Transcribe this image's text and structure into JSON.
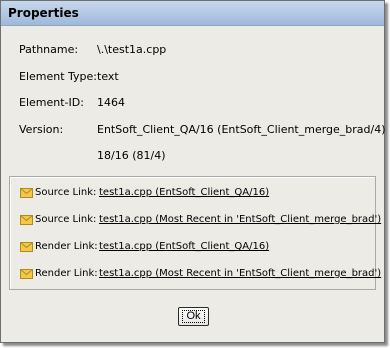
{
  "window": {
    "title": "Properties"
  },
  "properties": [
    {
      "label": "Pathname:",
      "value": "\\.\\test1a.cpp"
    },
    {
      "label": "Element Type:",
      "value": "text"
    },
    {
      "label": "Element-ID:",
      "value": "1464"
    },
    {
      "label": "Version:",
      "value": "EntSoft_Client_QA/16 (EntSoft_Client_merge_brad/4)"
    },
    {
      "label": "",
      "value": "18/16 (81/4)"
    }
  ],
  "links": [
    {
      "icon": "envelope-icon",
      "label": "Source Link:",
      "text": "test1a.cpp (EntSoft_Client_QA/16)"
    },
    {
      "icon": "envelope-icon",
      "label": "Source Link:",
      "text": "test1a.cpp (Most Recent in 'EntSoft_Client_merge_brad')"
    },
    {
      "icon": "envelope-icon",
      "label": "Render Link:",
      "text": "test1a.cpp (EntSoft_Client_QA/16)"
    },
    {
      "icon": "envelope-icon",
      "label": "Render Link:",
      "text": "test1a.cpp (Most Recent in 'EntSoft_Client_merge_brad')"
    }
  ],
  "buttons": {
    "ok_label": "Ok"
  },
  "colors": {
    "titlebar_top": "#c8d8ec",
    "titlebar_bottom": "#9fb9da",
    "dialog_background": "#ecebe6",
    "envelope_fill": "#f2c84b"
  }
}
